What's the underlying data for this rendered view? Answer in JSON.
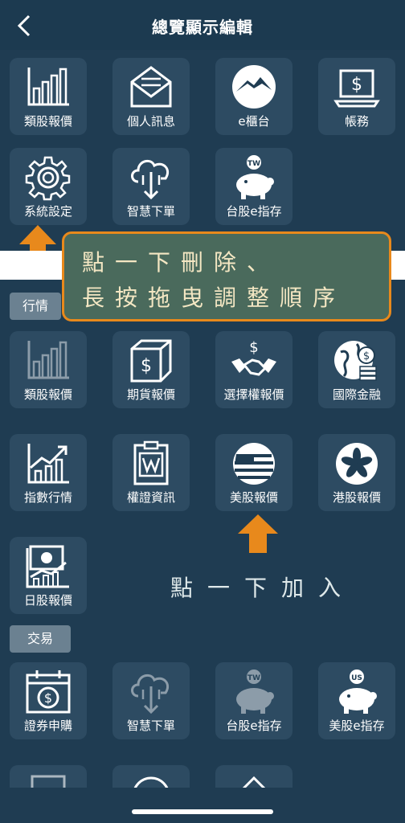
{
  "header": {
    "title": "總覽顯示編輯",
    "back_icon": "chevron-left-icon"
  },
  "favorites": [
    {
      "label": "類股報價",
      "icon": "bar-chart-icon"
    },
    {
      "label": "個人訊息",
      "icon": "mail-icon"
    },
    {
      "label": "e櫃台",
      "icon": "mountain-logo-icon"
    },
    {
      "label": "帳務",
      "icon": "laptop-dollar-icon"
    },
    {
      "label": "系統設定",
      "icon": "gear-icon"
    },
    {
      "label": "智慧下單",
      "icon": "cloud-download-icon"
    },
    {
      "label": "台股e指存",
      "icon": "piggy-bank-tw-icon"
    }
  ],
  "callout": {
    "line1": "點一下刪除、",
    "line2": "長按拖曳調整順序"
  },
  "sections": {
    "market": {
      "tag": "行情",
      "items": [
        {
          "label": "類股報價",
          "icon": "bar-chart-icon",
          "dim": true
        },
        {
          "label": "期貨報價",
          "icon": "box-dollar-icon"
        },
        {
          "label": "選擇權報價",
          "icon": "handshake-dollar-icon"
        },
        {
          "label": "國際金融",
          "icon": "globe-coins-icon"
        },
        {
          "label": "指數行情",
          "icon": "trend-chart-icon"
        },
        {
          "label": "權證資訊",
          "icon": "warrant-doc-icon"
        },
        {
          "label": "美股報價",
          "icon": "us-flag-icon"
        },
        {
          "label": "港股報價",
          "icon": "hk-flag-icon"
        },
        {
          "label": "日股報價",
          "icon": "jp-chart-icon"
        }
      ]
    },
    "trade": {
      "tag": "交易",
      "items": [
        {
          "label": "證券申購",
          "icon": "calendar-dollar-icon"
        },
        {
          "label": "智慧下單",
          "icon": "cloud-download-icon",
          "dim": true
        },
        {
          "label": "台股e指存",
          "icon": "piggy-bank-tw-icon",
          "dim": true
        },
        {
          "label": "美股e指存",
          "icon": "piggy-bank-us-icon"
        }
      ]
    }
  },
  "tap_to_add": "點一下加入",
  "colors": {
    "background": "#1f3c52",
    "tile": "#2d4b62",
    "accent": "#e8891c",
    "callout": "#4a6a5c"
  }
}
